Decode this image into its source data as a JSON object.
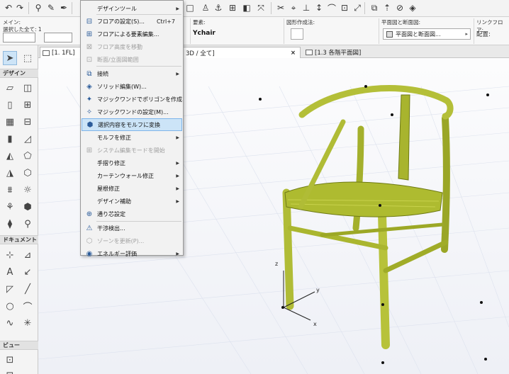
{
  "menu": {
    "items": [
      {
        "label": "デザインツール",
        "shortcut": "",
        "submenu": true,
        "disabled": false,
        "icon": "none"
      },
      {
        "label": "フロアの設定(S)...",
        "shortcut": "Ctrl+7",
        "submenu": false,
        "disabled": false,
        "icon": "floor-settings-icon"
      },
      {
        "label": "フロアによる要素編集...",
        "shortcut": "",
        "submenu": false,
        "disabled": false,
        "icon": "floor-edit-icon"
      },
      {
        "label": "フロア高度を移動",
        "shortcut": "",
        "submenu": false,
        "disabled": true,
        "icon": "floor-height-icon"
      },
      {
        "label": "断面/立面図範囲",
        "shortcut": "",
        "submenu": false,
        "disabled": true,
        "icon": "section-range-icon"
      },
      {
        "label": "接続",
        "shortcut": "",
        "submenu": true,
        "disabled": false,
        "icon": "connect-icon"
      },
      {
        "label": "ソリッド編集(W)...",
        "shortcut": "",
        "submenu": false,
        "disabled": false,
        "icon": "solid-edit-icon"
      },
      {
        "label": "マジックワンドでポリゴンを作成",
        "shortcut": "",
        "submenu": false,
        "disabled": false,
        "icon": "magic-wand-icon"
      },
      {
        "label": "マジックワンドの設定(M)...",
        "shortcut": "",
        "submenu": false,
        "disabled": false,
        "icon": "magic-wand-settings-icon"
      },
      {
        "label": "選択内容をモルフに変換",
        "shortcut": "",
        "submenu": false,
        "disabled": false,
        "icon": "convert-morph-icon"
      },
      {
        "label": "モルフを修正",
        "shortcut": "",
        "submenu": true,
        "disabled": false,
        "icon": "none"
      },
      {
        "label": "システム編集モードを開始",
        "shortcut": "",
        "submenu": false,
        "disabled": true,
        "icon": "system-edit-icon"
      },
      {
        "label": "手摺り修正",
        "shortcut": "",
        "submenu": true,
        "disabled": false,
        "icon": "none"
      },
      {
        "label": "カーテンウォール修正",
        "shortcut": "",
        "submenu": true,
        "disabled": false,
        "icon": "none"
      },
      {
        "label": "屋根修正",
        "shortcut": "",
        "submenu": true,
        "disabled": false,
        "icon": "none"
      },
      {
        "label": "デザイン補助",
        "shortcut": "",
        "submenu": true,
        "disabled": false,
        "icon": "none"
      },
      {
        "label": "通り芯設定",
        "shortcut": "",
        "submenu": false,
        "disabled": false,
        "icon": "grid-icon"
      },
      {
        "label": "干渉検出...",
        "shortcut": "",
        "submenu": false,
        "disabled": false,
        "icon": "collision-icon"
      },
      {
        "label": "ゾーンを更新(P)...",
        "shortcut": "",
        "submenu": false,
        "disabled": true,
        "icon": "zone-update-icon"
      },
      {
        "label": "エネルギー評価",
        "shortcut": "",
        "submenu": true,
        "disabled": false,
        "icon": "energy-icon"
      }
    ]
  },
  "infobar": {
    "main_label": "メイン:",
    "selection_label": "選択した全て: 1",
    "element_label": "要素:",
    "element_value": "Ychair",
    "shape_label": "図形作成法:",
    "plan_label": "平面図と断面図:",
    "plan_value": "平面図と断面図...",
    "link_label": "リンクフロア:",
    "placement_label": "配置:"
  },
  "toolbox": {
    "design_header": "デザイン",
    "document_header": "ドキュメント",
    "view_header": "ビュー"
  },
  "tabs": {
    "floor": "[1. 1FL]",
    "view3d": "3D / 全て]",
    "plan": "[1.3 各階平面図]",
    "close": "×"
  },
  "axes": {
    "x": "x",
    "y": "y",
    "z": "z"
  },
  "colors": {
    "highlight": "#cce4f7",
    "chair": "#b7c23a",
    "chair_dark": "#7f8a1c"
  }
}
